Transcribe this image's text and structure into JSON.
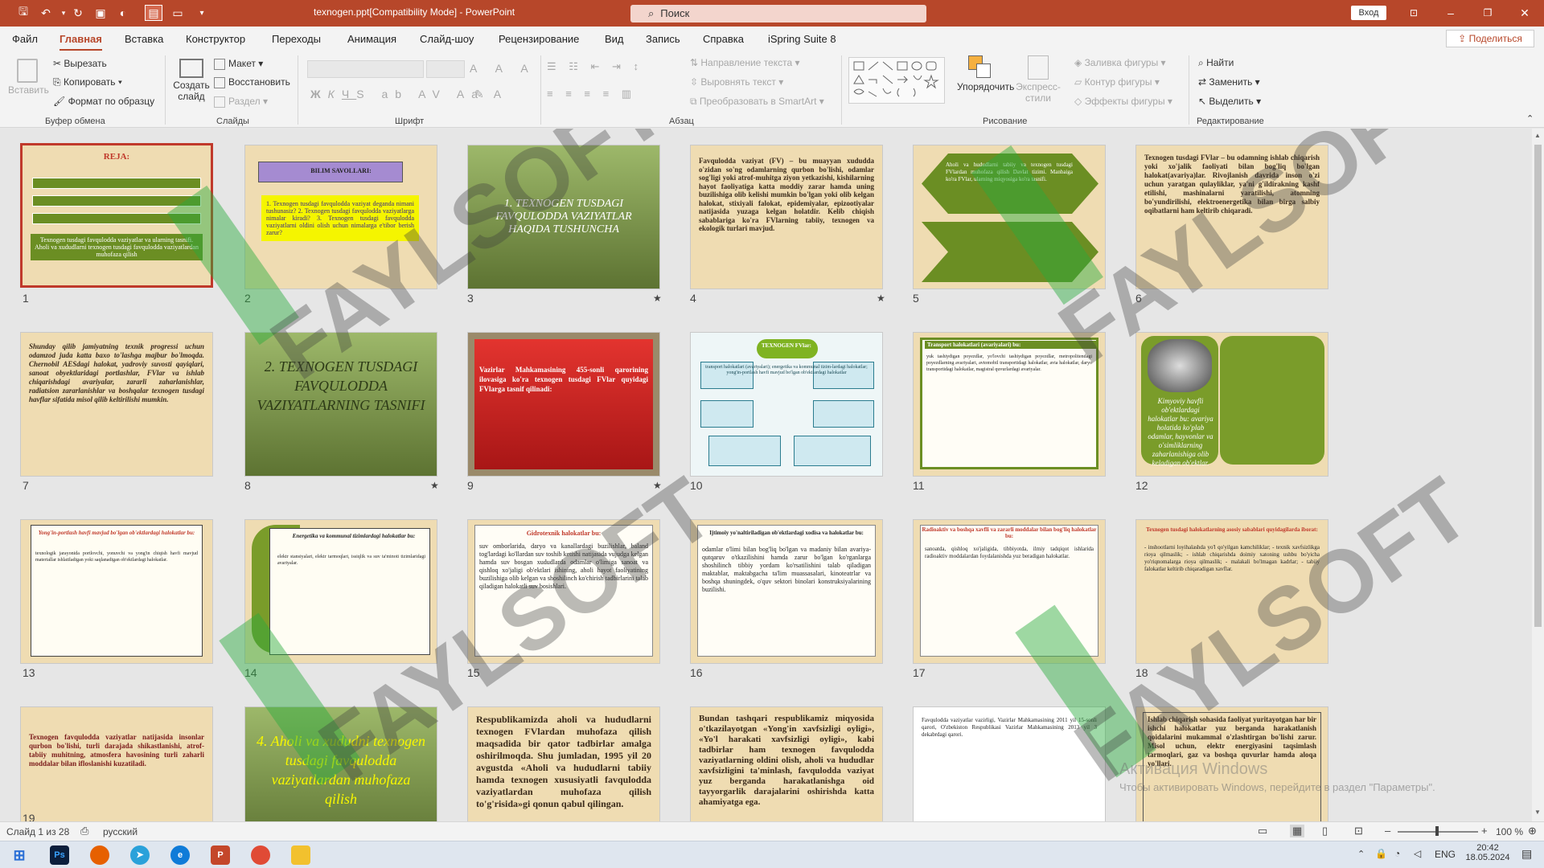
{
  "titlebar": {
    "doc_title": "texnogen.ppt[Compatibility Mode] - PowerPoint",
    "search_placeholder": "Поиск",
    "signin": "Вход"
  },
  "menu": {
    "tabs": [
      "Файл",
      "Главная",
      "Вставка",
      "Конструктор",
      "Переходы",
      "Анимация",
      "Слайд-шоу",
      "Рецензирование",
      "Вид",
      "Запись",
      "Справка",
      "iSpring Suite 8"
    ],
    "active": "Главная",
    "share": "Поделиться"
  },
  "ribbon": {
    "clipboard": {
      "paste": "Вставить",
      "cut": "Вырезать",
      "copy": "Копировать",
      "format": "Формат по образцу",
      "label": "Буфер обмена"
    },
    "slides": {
      "new": "Создать слайд",
      "layout": "Макет",
      "reset": "Восстановить",
      "section": "Раздел",
      "label": "Слайды"
    },
    "font": {
      "label": "Шрифт"
    },
    "paragraph": {
      "text_dir": "Направление текста",
      "align_text": "Выровнять текст",
      "smartart": "Преобразовать в SmartArt",
      "label": "Абзац"
    },
    "drawing": {
      "arrange": "Упорядочить",
      "quick_styles": "Экспресс-стили",
      "fill": "Заливка фигуры",
      "outline": "Контур фигуры",
      "effects": "Эффекты фигуры",
      "label": "Рисование"
    },
    "editing": {
      "find": "Найти",
      "replace": "Заменить",
      "select": "Выделить",
      "label": "Редактирование"
    }
  },
  "slides": [
    {
      "n": "1",
      "title": "REJA:",
      "text": "Texnogen tusdagi favqulodda vaziyatlar va ularning tasnifi. Aholi va xududlarni texnogen tusdagi favqulodda vaziyatlardan muhofaza qilish",
      "star": false
    },
    {
      "n": "2",
      "title": "BILIM SAVOLLARI:",
      "text": "1. Texnogen tusdagi favqulodda vaziyat deganda nimani tushunasiz? 2. Texnogen tusdagi favqulodda vaziyatlarga nimalar kiradi? 3. Texnogen tusdagi favqulodda vaziyatlarni oldini olish uchun nimalarga e'tibor berish zarur?",
      "star": false
    },
    {
      "n": "3",
      "title": "",
      "text": "1. TEXNOGEN TUSDAGI FAVQULODDA VAZIYATLAR HAQIDA TUSHUNCHA",
      "star": true
    },
    {
      "n": "4",
      "title": "",
      "text": "Favqulodda vaziyat (FV) – bu muayyan xududda o'zidan so'ng odamlarning qurbon bo'lishi, odamlar sog'ligi yoki atrof-muhitga ziyon yetkazishi, kishilarning hayot faoliyatiga katta moddiy zarar hamda uning buzilishiga olib kelishi mumkin bo'lgan yoki olib kelgan halokat, stixiyali falokat, epidemiyalar, epizootiyalar natijasida yuzaga kelgan holatdir. Kelib chiqish sabablariga ko'ra FVlarning tabiiy, texnogen va ekologik turlari mavjud.",
      "star": true
    },
    {
      "n": "5",
      "title": "",
      "text": "Aholi va hududlarni tabiiy va texnogen tusdagi FVlardan muhofaza qilish Davlat tizimi. Manbaiga ko'ra FVlar, ularning miqyosiga ko'ra tasnifi.",
      "star": false
    },
    {
      "n": "6",
      "title": "",
      "text": "Texnogen tusdagi FVlar – bu odamning ishlab chiqarish yoki xo'jalik faoliyati bilan bog'liq bo'lgan halokat(avariya)lar. Rivojlanish davrida inson o'zi uchun yaratgan qulayliklar, ya'ni g'ildirakning kashf etilishi, mashinalarni yaratilishi, atomning bo'yundirilishi, elektroenergetika bilan birga salbiy oqibatlarni ham keltirib chiqaradi.",
      "star": false
    },
    {
      "n": "7",
      "title": "",
      "text": "Shunday qilib jamiyatning texnik progressi uchun odamzod juda katta baxo to'lashga majbur bo'lmoqda. Chernobil AESdagi halokat, yadroviy suvosti qayiqlari, sanoat obyektlaridagi portlashlar, FVlar va ishlab chiqarishdagi avariyalar, zararli zaharlanishlar, radiatsion zararlanishlar va boshqalar texnogen tusdagi havflar sifatida misol qilib keltirilishi mumkin.",
      "star": false
    },
    {
      "n": "8",
      "title": "",
      "text": "2. TEXNOGEN TUSDAGI FAVQULODDA VAZIYATLARNING TASNIFI",
      "star": true
    },
    {
      "n": "9",
      "title": "",
      "text": "Vazirlar Mahkamasining 455-sonli qarorining ilovasiga ko'ra texnogen tusdagi FVlar quyidagi FVlarga tasnif qilinadi:",
      "star": true
    },
    {
      "n": "10",
      "title": "TEXNOGEN FVlar:",
      "text": "transport halokatlari (avariyalari); energetika va kommunal tizim-lardagi halokatlar; yong'in-portlash havfi mavjud bo'lgan ob'ektlardagi halokatlar",
      "star": false
    },
    {
      "n": "11",
      "title": "Transport halokatlari (avariyalari) bu:",
      "text": "yuk tashiydigan poyezdlar, yo'lovchi tashiydigan poyezdlar, metropolitendagi poyezdlarning avariyalari, avtomobil transportidagi halokatlar, avia halokatlar, daryo transportidagi halokatlar, magistral quvurlardagi avariyalar.",
      "star": false
    },
    {
      "n": "12",
      "title": "",
      "text": "Kimyoviy havfli ob'ektlardagi halokatlar bu: avariya holatida ko'plab odamlar, hayvonlar va o'simliklarning zaharlanishiga olib keladigan ob'ektlar.",
      "star": false
    },
    {
      "n": "13",
      "title": "Yong'in-portlash havfi mavjud bo'lgan ob'ektlardagi halokatlar bu:",
      "text": "texnologik jarayonida portlovchi, yonuvchi va yong'in chiqish havfi mavjud materiallar ishlatiladigan yoki saqlanadigan ob'ektlardagi halokatlar.",
      "star": false
    },
    {
      "n": "14",
      "title": "Energetika va kommunal tizimlardagi halokatlar bu:",
      "text": "elektr stansiyalari, elektr tarmoqlari, issiqlik va suv ta'minoti tizimlaridagi avariyalar.",
      "star": false
    },
    {
      "n": "15",
      "title": "Gidrotexnik halokatlar bu:",
      "text": "suv omborlarida, daryo va kanallardagi buzilishlar, baland tog'lardagi ko'llardan suv toshib ketishi natijasida vujudga kelgan hamda suv bosgan xududlarda odamlar o'limiga sanoat va qishloq xo'jaligi ob'ektlari ishining, aholi hayot faoliyatining buzilishiga olib kelgan va shoshilinch ko'chirish tadbirlarini talab qiladigan halokatli suv bosishlari.",
      "star": false
    },
    {
      "n": "16",
      "title": "Ijtimoiy yo'naltiriladigan ob'ektlardagi xodisa va halokatlar bu:",
      "text": "odamlar o'limi bilan bog'liq bo'lgan va madaniy bilan avariya-qutqaruv o'tkazilishini hamda zarur bo'lgan ko'rganlarga shoshilinch tibbiy yordam ko'rsatilishini talab qiladigan maktablar, maktabgacha ta'lim muassasalari, kinoteatrlar va boshqa shuningdek, o'quv sektori binolari konstruksiyalarining buzilishi.",
      "star": false
    },
    {
      "n": "17",
      "title": "Radioaktiv va boshqa xavfli va zararli moddalar bilan bog'liq halokatlar bu:",
      "text": "sanoatda, qishloq xo'jaligida, tibbiyotda, ilmiy tadqiqot ishlarida radioaktiv moddalardan foydalanishda yuz beradigan halokatlar.",
      "star": false
    },
    {
      "n": "18",
      "title": "Texnogen tusdagi halokatlarning asosiy sabablari quyidagilarda iborat:",
      "text": "- inshootlarni loyihalashda yo'l qo'yilgan kamchiliklar; - texnik xavfsizlikga rioya qilmaslik; - ishlab chiqarishda doimiy xatoning ushbu bo'yicha yo'riqnomalarga rioya qilmaslik; - malakali bo'lmagan kadrlar; - tabiiy falokatlar keltirib chiqaradigan xavflar.",
      "star": false
    },
    {
      "n": "19",
      "title": "",
      "text": "Texnogen favqulodda vaziyatlar natijasida insonlar qurbon bo'lishi, turli darajada shikastlanishi, atrof-tabiiy muhitning, atmosfera havosining turli zaharli moddalar bilan ifloslanishi kuzatiladi.",
      "star": false
    },
    {
      "n": "20",
      "title": "",
      "text": "4. Aholi va xududni texnogen tusdagi favqulodda vaziyatlardan muhofaza qilish",
      "star": false
    },
    {
      "n": "21",
      "title": "",
      "text": "Respublikamizda aholi va hududlarni texnogen FVlardan muhofaza qilish maqsadida bir qator tadbirlar amalga oshirilmoqda. Shu jumladan, 1995 yil 20 avgustda «Aholi va hududlarni tabiiy hamda texnogen xususiyatli favqulodda vaziyatlardan muhofaza qilish to'g'risida»gi qonun qabul qilingan.",
      "star": false
    },
    {
      "n": "22",
      "title": "",
      "text": "Bundan tashqari respublikamiz miqyosida o'tkazilayotgan «Yong'in xavfsizligi oyligi», «Yo'l harakati xavfsizligi oyligi», kabi tadbirlar ham texnogen favqulodda vaziyatlarning oldini olish, aholi va hududlar xavfsizligini ta'minlash, favqulodda vaziyat yuz berganda harakatlanishga oid tayyorgarlik darajalarini oshirishda katta ahamiyatga ega.",
      "star": false
    },
    {
      "n": "23",
      "title": "",
      "text": "Favqulodda vaziyatlar vazirligi, Vazirlar Mahkamasining 2011 yil 15-sonli qarori, O'zbekiston Respublikasi Vazirlar Mahkamasining 2013 yil 3 dekabrdagi qarori.",
      "star": false
    },
    {
      "n": "24",
      "title": "",
      "text": "Ishlab chiqarish sohasida faoliyat yuritayotgan har bir ishchi halokatlar yuz berganda harakatlanish qoidalarini mukammal o'zlashtirgan bo'lishi zarur. Misol uchun, elektr energiyasini taqsimlash tarmoqlari, gaz va boshqa quvurlar hamda aloqa yo'llari.",
      "star": false
    }
  ],
  "status": {
    "slide_info": "Слайд 1 из 28",
    "language": "русский",
    "zoom": "100 %"
  },
  "activation": {
    "title": "Активация Windows",
    "text": "Чтобы активировать Windows, перейдите в раздел \"Параметры\"."
  },
  "taskbar": {
    "lang": "ENG",
    "time": "20:42",
    "date": "18.05.2024"
  },
  "watermark": "FAYLSOFT"
}
